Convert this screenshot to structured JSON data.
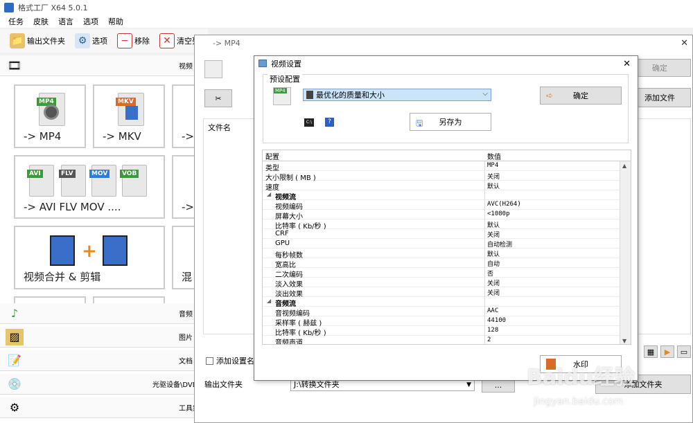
{
  "app": {
    "title": "格式工厂 X64 5.0.1"
  },
  "menu": [
    "任务",
    "皮肤",
    "语言",
    "选项",
    "帮助"
  ],
  "toolbar": {
    "output_folder": "输出文件夹",
    "options": "选项",
    "remove": "移除",
    "clear": "清空列"
  },
  "categories": {
    "video": "视频",
    "audio": "音频",
    "image": "图片",
    "document": "文档",
    "disc": "光驱设备\\DVD",
    "tools": "工具集"
  },
  "tiles": {
    "mp4": "-> MP4",
    "mkv": "-> MKV",
    "t3": "-> ",
    "multi": "-> AVI FLV MOV ....",
    "t5": "-> ",
    "merge": "视频合并 & 剪辑",
    "t7": "混"
  },
  "tile_tags": {
    "mp4": "MP4",
    "mkv": "MKV",
    "avi": "AVI",
    "flv": "FLV",
    "mov": "MOV",
    "vob": "VOB"
  },
  "mp4_dialog": {
    "title": "-> MP4",
    "ok": "确定",
    "add_file": "添加文件",
    "file_col": "文件名",
    "add_settings_name": "添加设置名称",
    "output_folder_label": "输出文件夹",
    "output_folder_value": "J:\\转换文件夹",
    "add_folder": "添加文件夹",
    "watermark": "水印",
    "dots": "..."
  },
  "video_settings": {
    "title": "视频设置",
    "preset_group": "预设配置",
    "preset_value": "最优化的质量和大小",
    "ok": "确定",
    "save_as": "另存为",
    "cmd_icon": "C:\\",
    "help_icon": "?",
    "col_config": "配置",
    "col_value": "数值",
    "rows": [
      {
        "k": "类型",
        "v": "MP4",
        "lvl": 0
      },
      {
        "k": "大小限制 ( MB )",
        "v": "关闭",
        "lvl": 0
      },
      {
        "k": "速度",
        "v": "默认",
        "lvl": 0
      },
      {
        "k": "视频流",
        "v": "",
        "lvl": 1,
        "cat": true
      },
      {
        "k": "视频编码",
        "v": "AVC(H264)",
        "lvl": 2
      },
      {
        "k": "屏幕大小",
        "v": "<1080p",
        "lvl": 2
      },
      {
        "k": "比特率 ( Kb/秒 )",
        "v": "默认",
        "lvl": 2
      },
      {
        "k": "CRF",
        "v": "关闭",
        "lvl": 2
      },
      {
        "k": "GPU",
        "v": "自动检测",
        "lvl": 2
      },
      {
        "k": "每秒帧数",
        "v": "默认",
        "lvl": 2
      },
      {
        "k": "宽高比",
        "v": "自动",
        "lvl": 2
      },
      {
        "k": "二次编码",
        "v": "否",
        "lvl": 2
      },
      {
        "k": "淡入效果",
        "v": "关闭",
        "lvl": 2
      },
      {
        "k": "淡出效果",
        "v": "关闭",
        "lvl": 2
      },
      {
        "k": "音频流",
        "v": "",
        "lvl": 1,
        "cat": true
      },
      {
        "k": "音视频编码",
        "v": "AAC",
        "lvl": 2
      },
      {
        "k": "采样率 ( 赫兹 )",
        "v": "44100",
        "lvl": 2
      },
      {
        "k": "比特率 ( Kb/秒 )",
        "v": "128",
        "lvl": 2
      },
      {
        "k": "音频声道",
        "v": "2",
        "lvl": 2
      }
    ]
  },
  "watermark_site": {
    "brand": "Baidu经验",
    "url": "jingyan.baidu.com"
  }
}
